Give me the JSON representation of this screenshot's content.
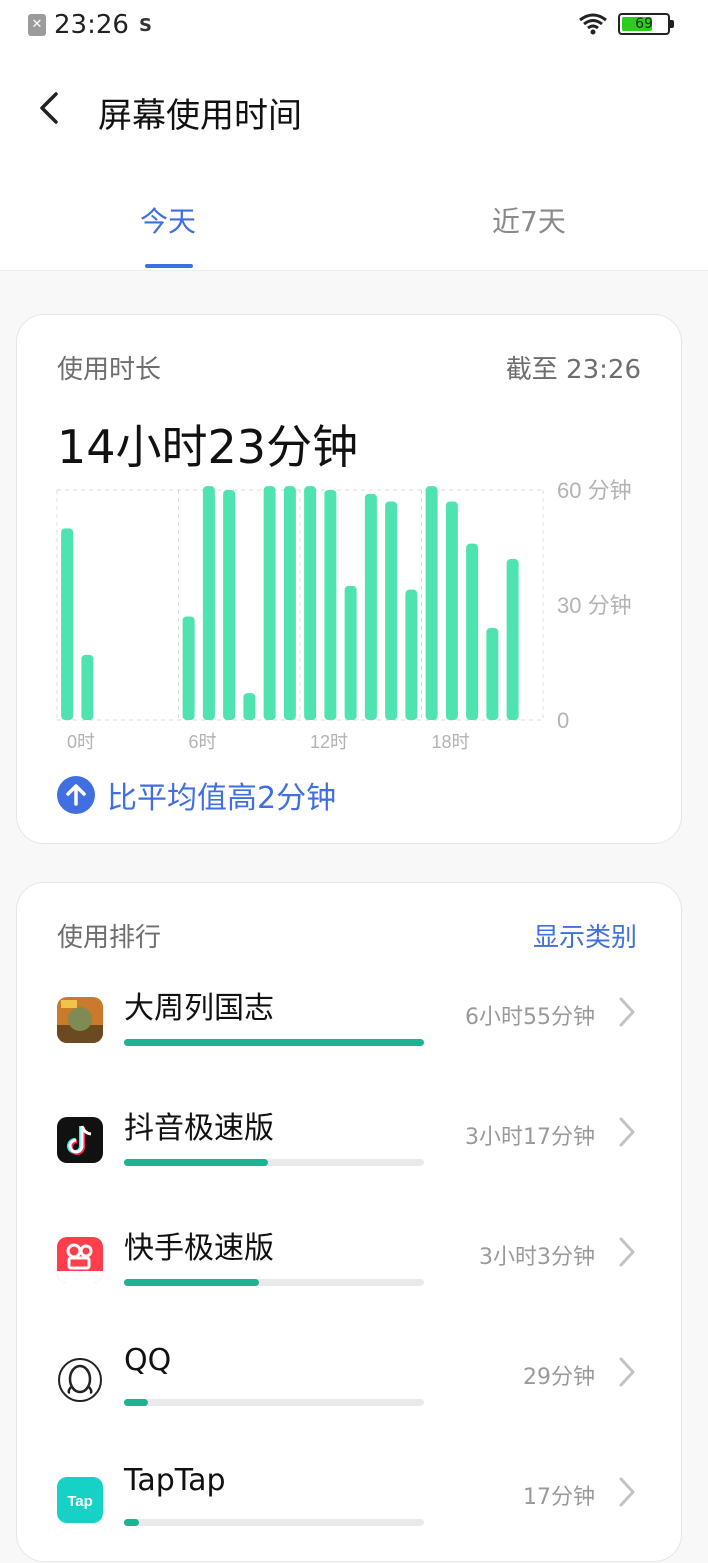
{
  "status_bar": {
    "time": "23:26",
    "battery": "69",
    "battery_level_pct": 69
  },
  "header": {
    "title": "屏幕使用时间"
  },
  "tabs": [
    {
      "label": "今天",
      "active": true
    },
    {
      "label": "近7天",
      "active": false
    }
  ],
  "usage_card": {
    "label": "使用时长",
    "as_of": "截至 23:26",
    "total": "14小时23分钟",
    "comparison": "比平均值高2分钟"
  },
  "chart_data": {
    "type": "bar",
    "unit": "分钟",
    "x": [
      0,
      1,
      2,
      3,
      4,
      5,
      6,
      7,
      8,
      9,
      10,
      11,
      12,
      13,
      14,
      15,
      16,
      17,
      18,
      19,
      20,
      21,
      22,
      23
    ],
    "values": [
      50,
      17,
      0,
      0,
      0,
      0,
      27,
      61,
      60,
      7,
      61,
      61,
      61,
      60,
      35,
      59,
      57,
      34,
      61,
      57,
      46,
      24,
      42,
      0
    ],
    "xtick_labels": [
      "0时",
      "6时",
      "12时",
      "18时"
    ],
    "xtick_positions": [
      0,
      6,
      12,
      18
    ],
    "ytick_labels": [
      "60 分钟",
      "30 分钟",
      "0"
    ],
    "ytick_values": [
      60,
      30,
      0
    ],
    "ylim": [
      0,
      60
    ],
    "bar_color": "#4fe3b0",
    "grid": "dashed vertical every 6 hours"
  },
  "ranking": {
    "label": "使用排行",
    "link": "显示类别",
    "apps": [
      {
        "name": "大周列国志",
        "time": "6小时55分钟",
        "fraction": 1.0,
        "icon": "game-icon"
      },
      {
        "name": "抖音极速版",
        "time": "3小时17分钟",
        "fraction": 0.48,
        "icon": "douyin-icon"
      },
      {
        "name": "快手极速版",
        "time": "3小时3分钟",
        "fraction": 0.45,
        "icon": "kuaishou-icon"
      },
      {
        "name": "QQ",
        "time": "29分钟",
        "fraction": 0.08,
        "icon": "qq-icon"
      },
      {
        "name": "TapTap",
        "time": "17分钟",
        "fraction": 0.05,
        "icon": "taptap-icon"
      }
    ]
  },
  "colors": {
    "accent": "#3f6fe0",
    "bar": "#4fe3b0",
    "progress": "#1db392"
  }
}
